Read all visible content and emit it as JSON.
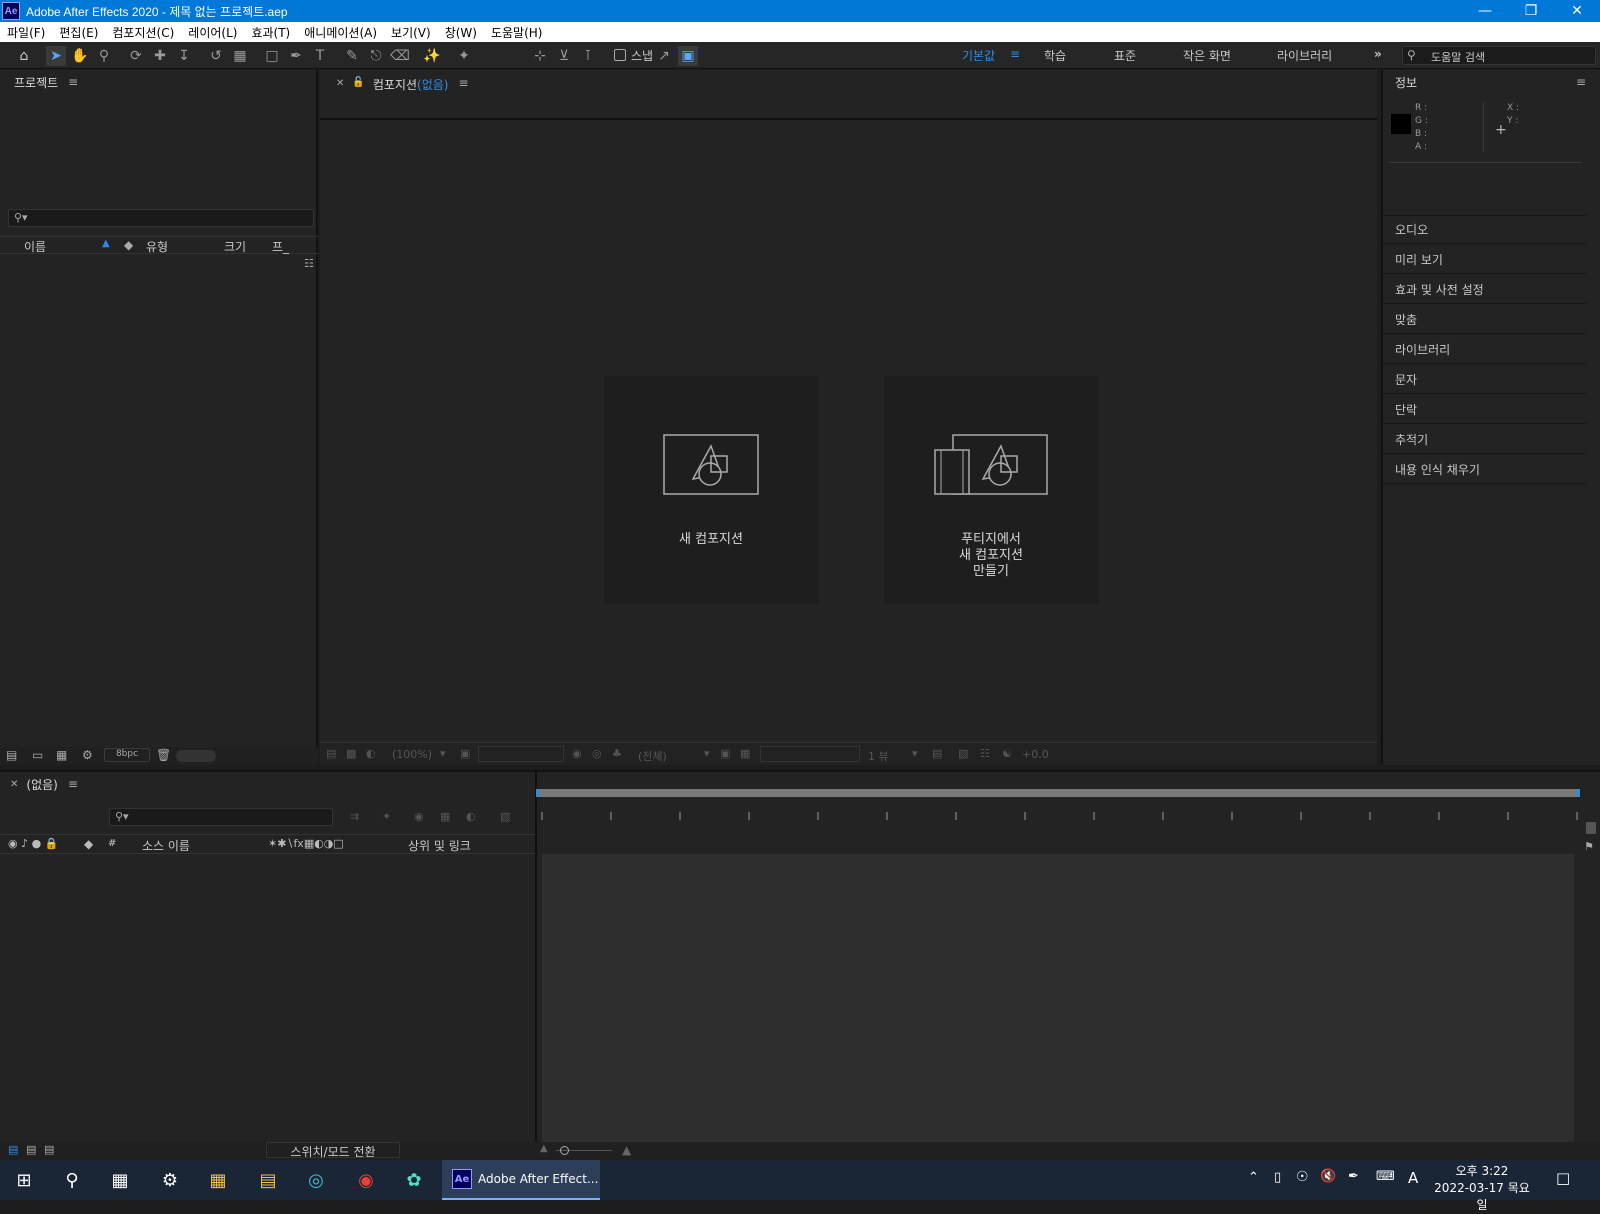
{
  "window": {
    "title": "Adobe After Effects 2020 - 제목 없는 프로젝트.aep",
    "logo": "Ae"
  },
  "menu": [
    "파일(F)",
    "편집(E)",
    "컴포지션(C)",
    "레이어(L)",
    "효과(T)",
    "애니메이션(A)",
    "보기(V)",
    "창(W)",
    "도움말(H)"
  ],
  "toolbar": {
    "snap_label": "스냅",
    "workspaces": [
      "기본값",
      "학습",
      "표준",
      "작은 화면",
      "라이브러리"
    ],
    "active_workspace": "기본값",
    "help_search_placeholder": "도움말 검색"
  },
  "project": {
    "title": "프로젝트",
    "columns": [
      "이름",
      "유형",
      "크기",
      "프_"
    ],
    "bpc": "8bpc"
  },
  "comp": {
    "tab_label": "컴포지션",
    "tab_none": "(없음)",
    "card1": "새 컴포지션",
    "card2_l1": "푸티지에서",
    "card2_l2": "새 컴포지션",
    "card2_l3": "만들기",
    "zoom": "(100%)",
    "resolution": "(전체)",
    "views": "1 뷰",
    "exposure": "+0.0"
  },
  "info": {
    "title": "정보",
    "r": "R :",
    "g": "G :",
    "b": "B :",
    "a": "A :",
    "x": "X :",
    "y": "Y :",
    "panels": [
      "오디오",
      "미리 보기",
      "효과 및 사전 설정",
      "맞춤",
      "라이브러리",
      "문자",
      "단락",
      "추적기",
      "내용 인식 채우기"
    ]
  },
  "timeline": {
    "tab": "(없음)",
    "col_hash": "#",
    "col_source": "소스 이름",
    "col_parent": "상위 및 링크",
    "toggle": "스위치/모드 전환"
  },
  "taskbar": {
    "ae_label": "Adobe After Effect...",
    "time": "오후 3:22",
    "date": "2022-03-17 목요일",
    "ime": "A"
  },
  "colors": {
    "accent": "#2d8ceb",
    "titlebar": "#0078d7",
    "panel": "#232323"
  }
}
